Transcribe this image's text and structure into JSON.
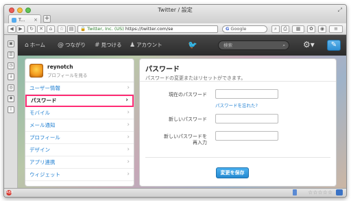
{
  "browser": {
    "window_title": "Twitter / 設定",
    "tab_title": "T...",
    "tab_close": "×",
    "new_tab": "+",
    "url_site": "Twitter, Inc. (US)",
    "url": "https://twitter.com/se",
    "search_engine": "G",
    "search_placeholder": "Google"
  },
  "twitter_nav": {
    "home": "ホーム",
    "connect": "つながり",
    "discover": "見つける",
    "account": "アカウント",
    "search_placeholder": "検索",
    "home_icon": "⌂",
    "connect_icon": "@",
    "discover_icon": "#",
    "account_icon": "♟"
  },
  "profile": {
    "username": "reynotch",
    "view_profile": "プロフィールを見る"
  },
  "menu": {
    "items": [
      {
        "label": "ユーザー情報"
      },
      {
        "label": "パスワード"
      },
      {
        "label": "モバイル"
      },
      {
        "label": "メール通知"
      },
      {
        "label": "プロフィール"
      },
      {
        "label": "デザイン"
      },
      {
        "label": "アプリ連携"
      },
      {
        "label": "ウィジェット"
      }
    ],
    "active_index": 1
  },
  "content": {
    "title": "パスワード",
    "subtitle": "パスワードの変更またはリセットができます。",
    "current_password_label": "現在のパスワード",
    "forgot_link": "パスワードを忘れた?",
    "new_password_label": "新しいパスワード",
    "confirm_password_label_1": "新しいパスワードを",
    "confirm_password_label_2": "再入力",
    "save_button": "変更を保存"
  },
  "colors": {
    "accent": "#1f7fd2",
    "active_border": "#ff2b74",
    "button_blue": "#2589d0",
    "topbar": "#333333"
  }
}
